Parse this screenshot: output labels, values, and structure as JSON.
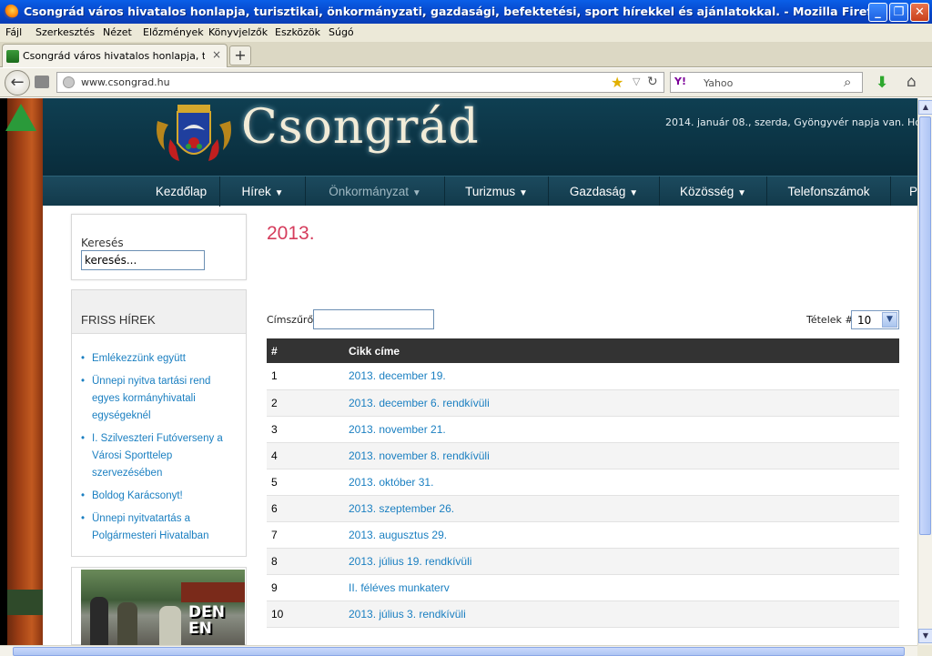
{
  "window": {
    "title": "Csongrád város hivatalos honlapja, turisztikai, önkormányzati, gazdasági, befektetési, sport hírekkel és ajánlatokkal. - Mozilla Firefox"
  },
  "menu": [
    "Fájl",
    "Szerkesztés",
    "Nézet",
    "Előzmények",
    "Könyvjelzők",
    "Eszközök",
    "Súgó"
  ],
  "tab": {
    "label": "Csongrád város hivatalos honlapja, turisztik...",
    "new_tab": "+"
  },
  "navbar": {
    "url": "www.csongrad.hu",
    "search_engine": "Y!",
    "search_placeholder": "Yahoo"
  },
  "site": {
    "logo": "Csongrád",
    "date_line": "2014. január 08., szerda, Gyöngyvér napja van. Holnap",
    "nav": [
      {
        "label": "Kezdőlap",
        "arrow": ""
      },
      {
        "label": "Hírek",
        "arrow": "▼"
      },
      {
        "label": "Önkormányzat",
        "arrow": "▼"
      },
      {
        "label": "Turizmus",
        "arrow": "▼"
      },
      {
        "label": "Gazdaság",
        "arrow": "▼"
      },
      {
        "label": "Közösség",
        "arrow": "▼"
      },
      {
        "label": "Telefonszámok",
        "arrow": ""
      },
      {
        "label": "P",
        "arrow": ""
      }
    ]
  },
  "sidebar": {
    "search_label": "Keresés",
    "search_value": "keresés...",
    "news_title": "FRISS HÍREK",
    "news": [
      "Emlékezzünk együtt",
      "Ünnepi nyitva tartási rend egyes kormányhivatali egységeknél",
      "I. Szilveszteri Futóverseny a Városi Sporttelep szervezésében",
      "Boldog Karácsonyt!",
      "Ünnepi nyitvatartás a Polgármesteri Hivatalban"
    ],
    "video_caption": "DEN\nEN"
  },
  "main": {
    "title": "2013.",
    "filter_label": "Címszűrő",
    "items_label": "Tételek #",
    "items_value": "10",
    "table_headers": [
      "#",
      "Cikk címe"
    ],
    "rows": [
      {
        "num": "1",
        "title": "2013. december 19."
      },
      {
        "num": "2",
        "title": "2013. december 6. rendkívüli"
      },
      {
        "num": "3",
        "title": "2013. november 21."
      },
      {
        "num": "4",
        "title": "2013. november 8. rendkívüli"
      },
      {
        "num": "5",
        "title": "2013. október 31."
      },
      {
        "num": "6",
        "title": "2013. szeptember 26."
      },
      {
        "num": "7",
        "title": "2013. augusztus 29."
      },
      {
        "num": "8",
        "title": "2013. július 19. rendkívüli"
      },
      {
        "num": "9",
        "title": "II. féléves munkaterv"
      },
      {
        "num": "10",
        "title": "2013. július 3. rendkívüli"
      }
    ]
  },
  "colors": {
    "accent_title": "#d53c5c",
    "link": "#1a7fc1",
    "header_bg": "#0f3f52",
    "table_header": "#333333"
  },
  "icons": [
    "firefox-icon",
    "back-arrow-icon",
    "globe-icon",
    "star-icon",
    "reload-icon",
    "magnifier-icon",
    "download-icon",
    "home-icon",
    "up-arrow-icon"
  ]
}
